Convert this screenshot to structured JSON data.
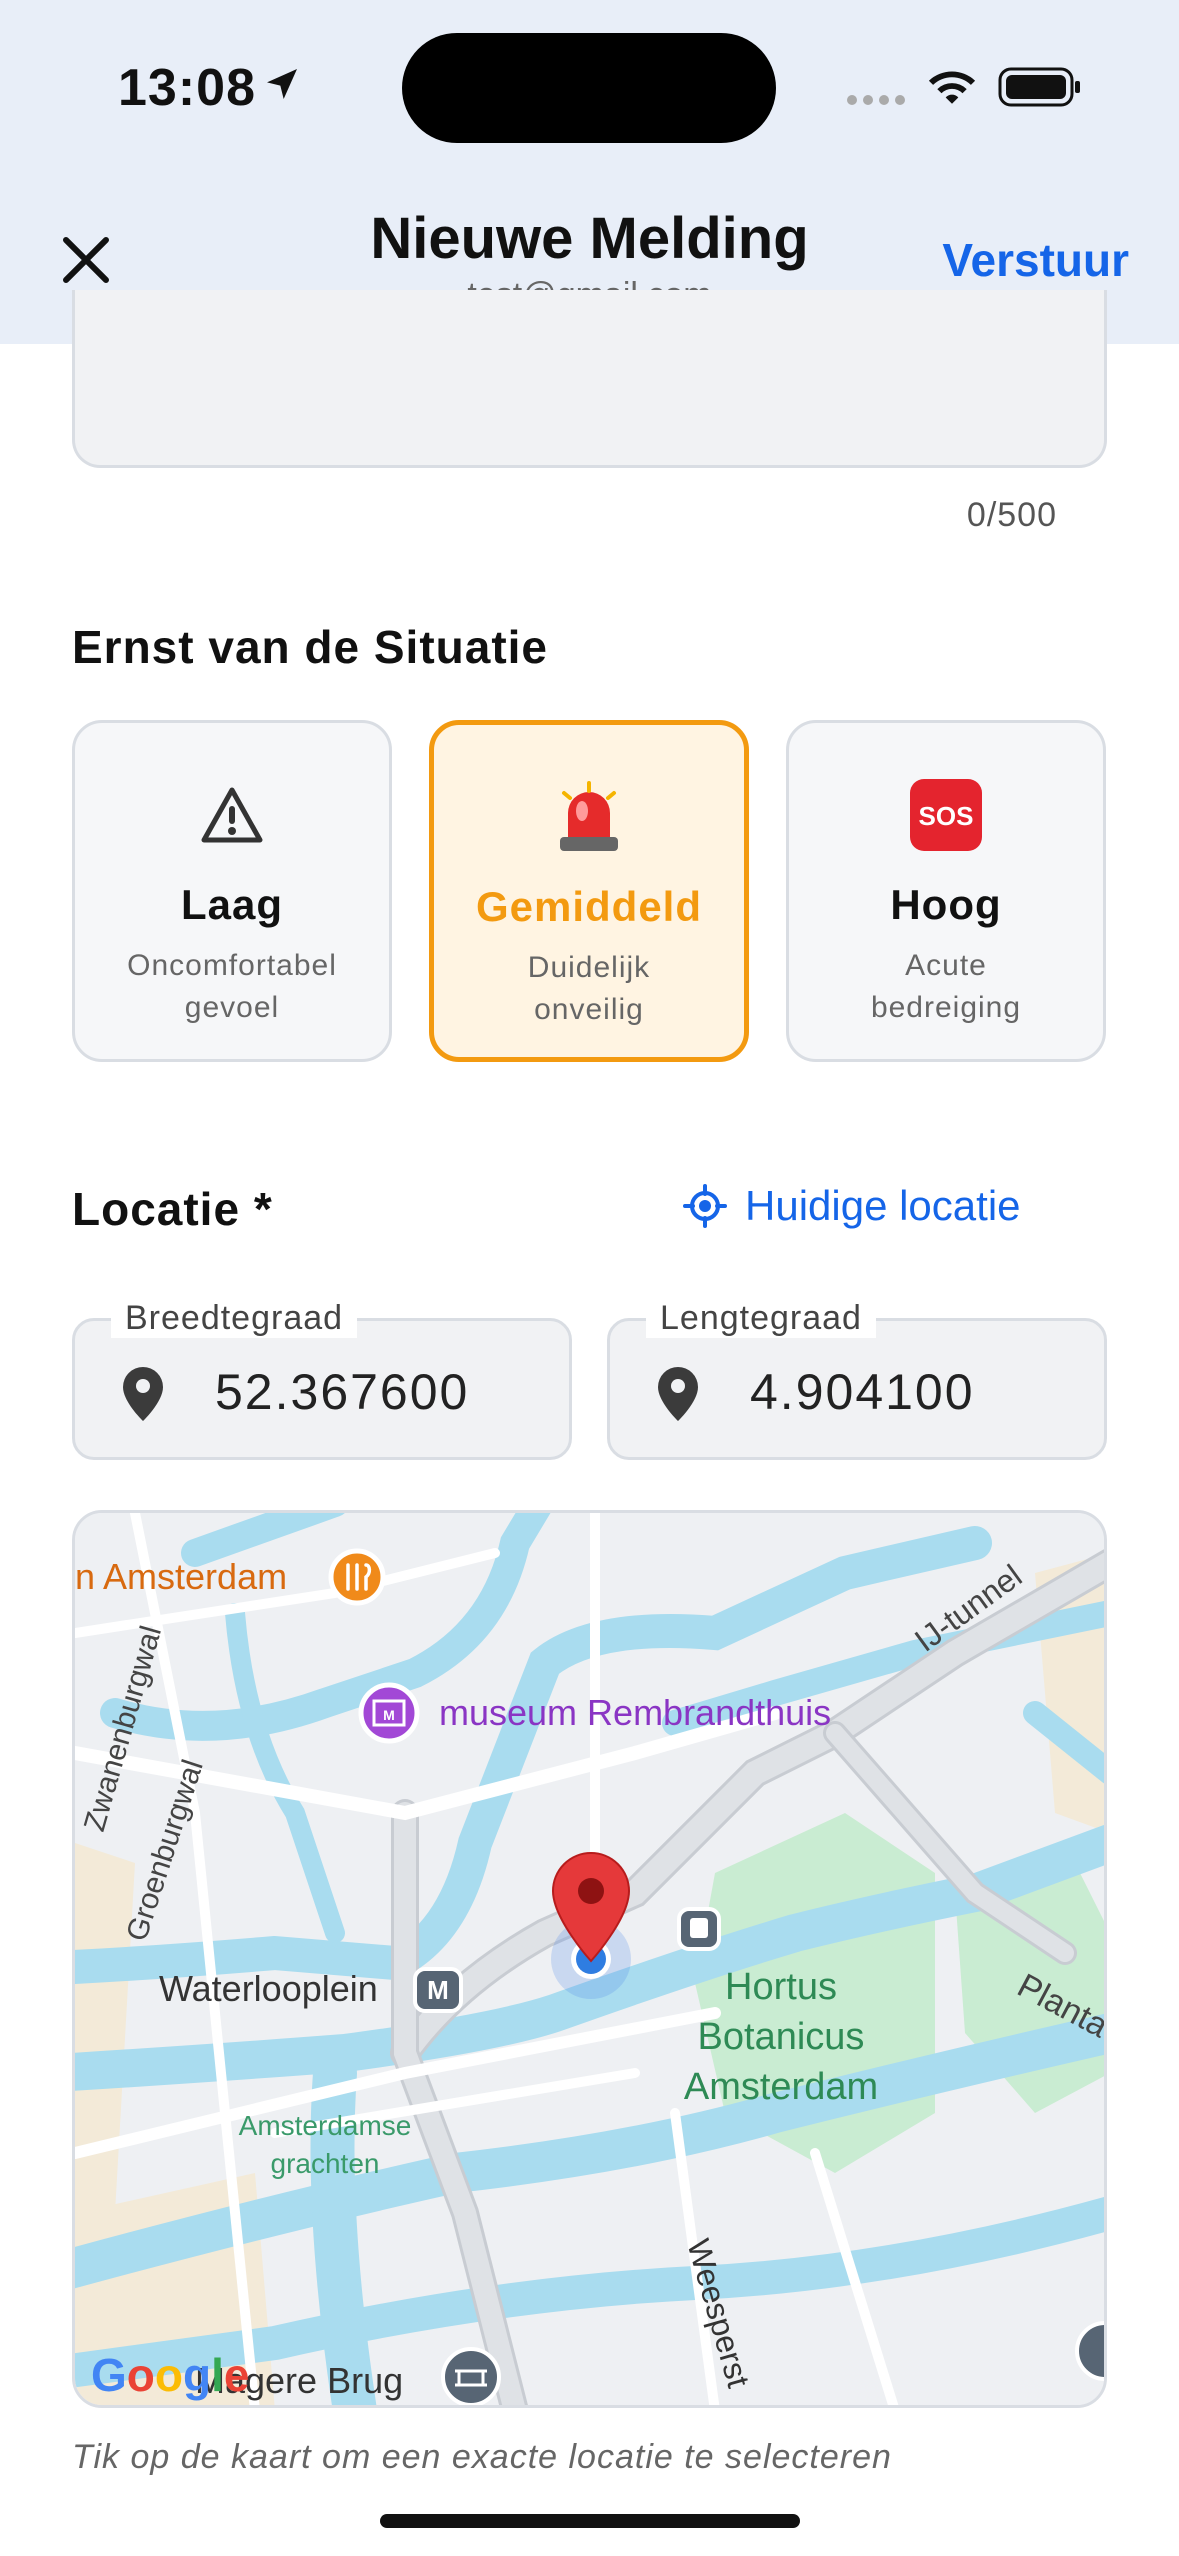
{
  "status_bar": {
    "time": "13:08"
  },
  "header": {
    "title": "Nieuwe Melding",
    "subtitle": "test@gmail.com",
    "send_label": "Verstuur"
  },
  "description": {
    "counter": "0/500"
  },
  "severity": {
    "title": "Ernst van de Situatie",
    "options": [
      {
        "label": "Laag",
        "desc_line1": "Oncomfortabel",
        "desc_line2": "gevoel",
        "icon": "warning-icon"
      },
      {
        "label": "Gemiddeld",
        "desc_line1": "Duidelijk",
        "desc_line2": "onveilig",
        "icon": "siren-icon",
        "selected": true
      },
      {
        "label": "Hoog",
        "desc_line1": "Acute",
        "desc_line2": "bedreiging",
        "icon": "sos-icon"
      }
    ]
  },
  "location": {
    "title": "Locatie *",
    "current_location_label": "Huidige locatie",
    "latitude_label": "Breedtegraad",
    "latitude_value": "52.367600",
    "longitude_label": "Lengtegraad",
    "longitude_value": "4.904100"
  },
  "map": {
    "labels": {
      "restaurant": "n Amsterdam",
      "museum": "museum Rembrandthuis",
      "ij_tunnel": "IJ-tunnel",
      "street1": "Zwanenburgwal",
      "street2": "Groenburgwal",
      "metro": "Waterlooplein",
      "hortus1": "Hortus",
      "hortus2": "Botanicus",
      "hortus3": "Amsterdam",
      "grachten1": "Amsterdamse",
      "grachten2": "grachten",
      "plantage": "Planta",
      "weesper": "Weesperst",
      "brug": "Magere Brug",
      "google": "Google"
    }
  },
  "hint": "Tik op de kaart om een exacte locatie te selecteren",
  "colors": {
    "accent": "#1565e8",
    "selected": "#f39a10",
    "water": "#a9dcef",
    "park": "#c9ecd2"
  }
}
